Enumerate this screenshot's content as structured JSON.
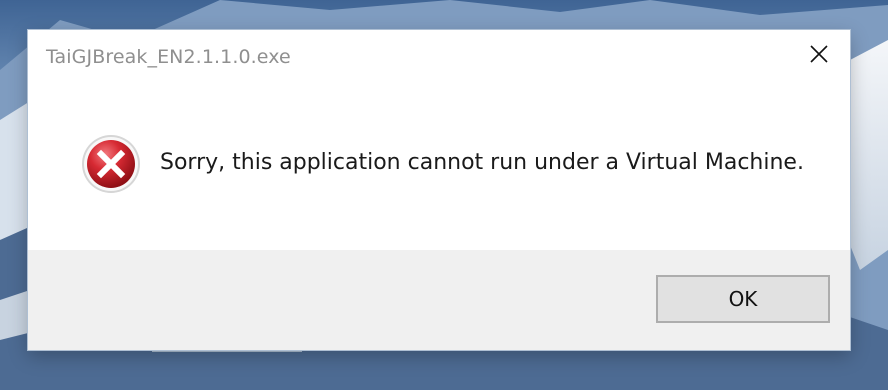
{
  "dialog": {
    "title": "TaiGJBreak_EN2.1.1.0.exe",
    "message": "Sorry, this application cannot run under a Virtual Machine.",
    "icon": "error-icon",
    "ok_label": "OK",
    "close_icon": "close-icon"
  },
  "colors": {
    "error_red": "#c8202a",
    "footer_bg": "#f0f0f0",
    "button_bg": "#e1e1e1",
    "title_text": "#8f8f8f"
  }
}
